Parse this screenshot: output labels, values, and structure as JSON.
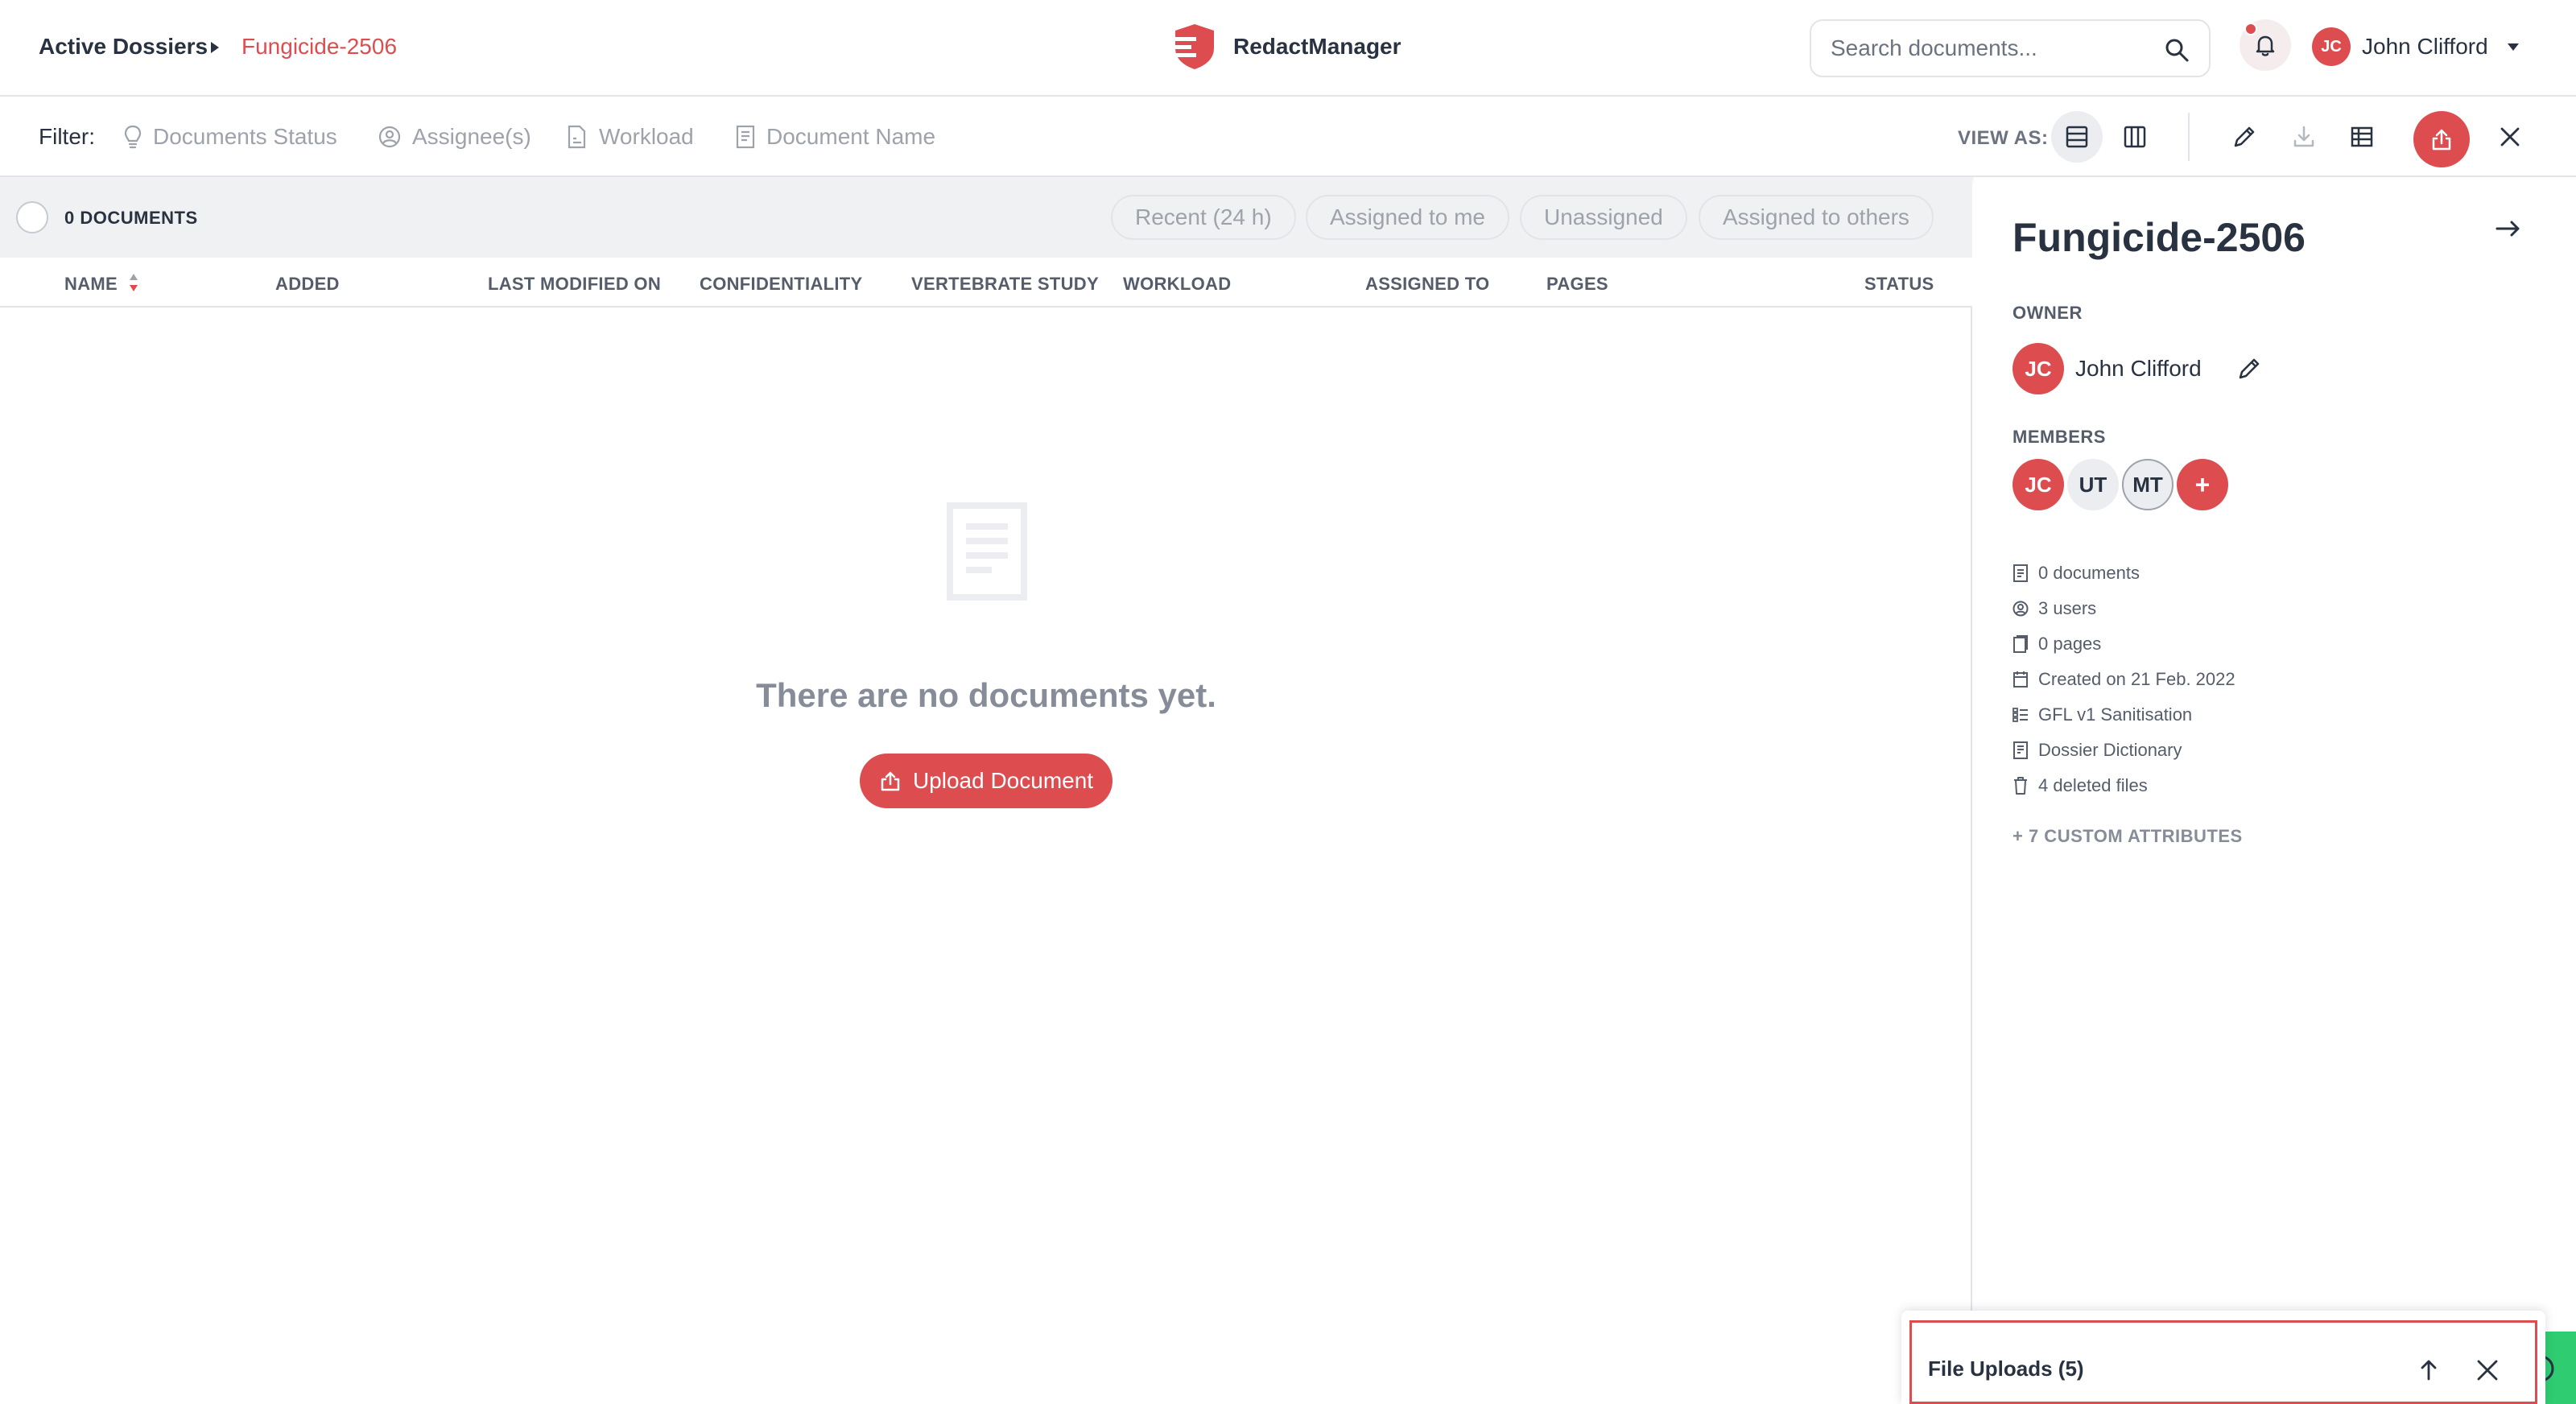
{
  "breadcrumb": {
    "root": "Active Dossiers",
    "current": "Fungicide-2506"
  },
  "brand": {
    "name": "RedactManager"
  },
  "search": {
    "placeholder": "Search documents..."
  },
  "user": {
    "initials": "JC",
    "name": "John Clifford"
  },
  "filter": {
    "label": "Filter:",
    "items": [
      "Documents Status",
      "Assignee(s)",
      "Workload",
      "Document Name"
    ],
    "view_as_label": "VIEW AS:"
  },
  "list": {
    "count_label": "0 DOCUMENTS",
    "quick_filters": [
      "Recent (24 h)",
      "Assigned to me",
      "Unassigned",
      "Assigned to others"
    ],
    "columns": [
      "NAME",
      "ADDED",
      "LAST MODIFIED ON",
      "CONFIDENTIALITY",
      "VERTEBRATE STUDY",
      "WORKLOAD",
      "ASSIGNED TO",
      "PAGES",
      "STATUS"
    ],
    "empty_text": "There are no documents yet.",
    "upload_label": "Upload Document"
  },
  "panel": {
    "title": "Fungicide-2506",
    "owner_label": "OWNER",
    "owner": {
      "initials": "JC",
      "name": "John Clifford"
    },
    "members_label": "MEMBERS",
    "members": [
      "JC",
      "UT",
      "MT"
    ],
    "add_member": "+",
    "stats": [
      "0 documents",
      "3 users",
      "0 pages",
      "Created on 21 Feb. 2022",
      "GFL v1 Sanitisation",
      "Dossier Dictionary",
      "4 deleted files"
    ],
    "custom_attributes": "+ 7 CUSTOM ATTRIBUTES"
  },
  "uploads": {
    "title": "File Uploads (5)"
  },
  "colors": {
    "accent": "#dd4d50",
    "text": "#283241",
    "muted": "#9da2ab",
    "help": "#2fcc71"
  }
}
